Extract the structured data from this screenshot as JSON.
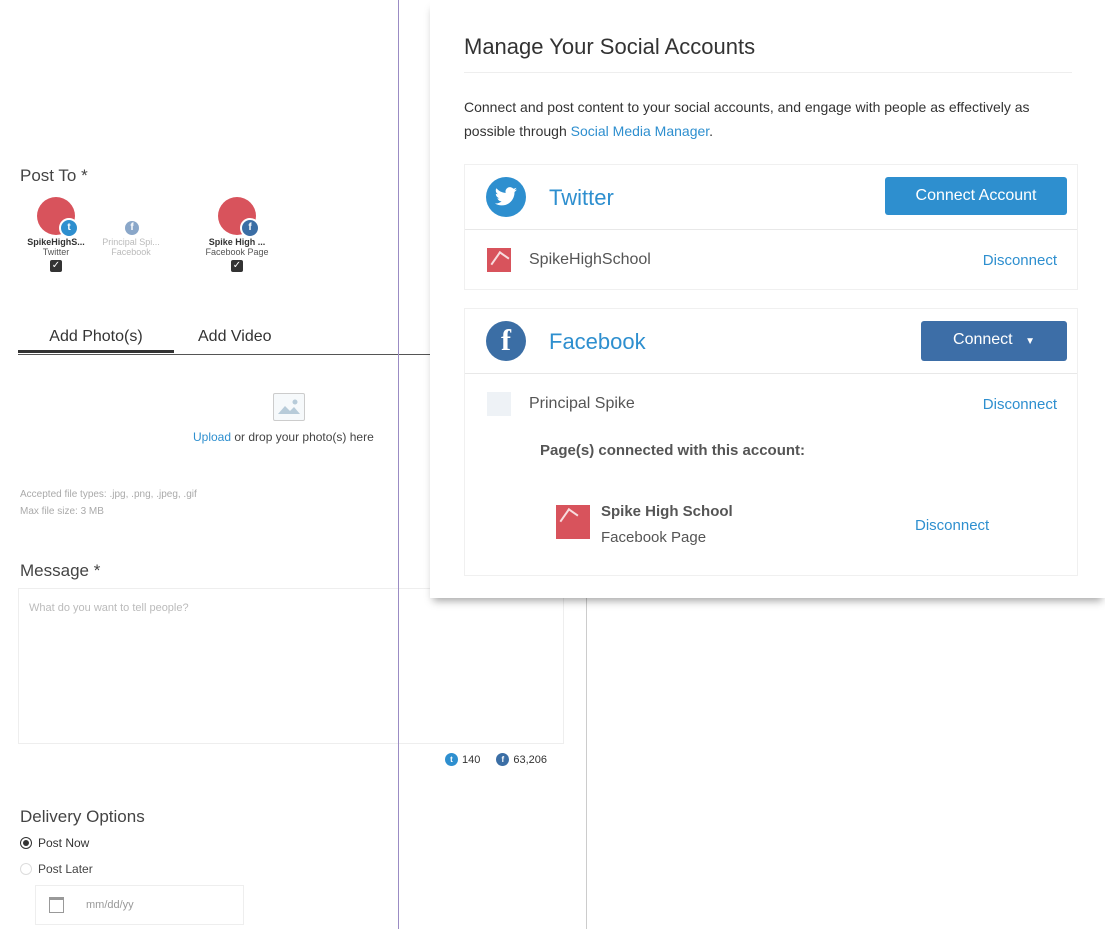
{
  "composer": {
    "post_to_label": "Post To *",
    "accounts": [
      {
        "name": "SpikeHighS...",
        "type": "Twitter",
        "checked": true,
        "network": "twitter"
      },
      {
        "name": "Principal Spi...",
        "type": "Facebook",
        "checked": false,
        "network": "facebook"
      },
      {
        "name": "Spike High ...",
        "type": "Facebook Page",
        "checked": true,
        "network": "facebook"
      }
    ],
    "tabs": [
      "Add Photo(s)",
      "Add Video"
    ],
    "upload": {
      "link": "Upload",
      "text": " or drop your photo(s) here"
    },
    "accepted_types": "Accepted file types: .jpg, .png, .jpeg, .gif",
    "max_size": "Max file size: 3 MB",
    "message_label": "Message *",
    "message_placeholder": "What do you want to tell people?",
    "counters": {
      "twitter": "140",
      "facebook": "63,206"
    },
    "delivery_label": "Delivery Options",
    "delivery_options": [
      {
        "label": "Post Now",
        "selected": true
      },
      {
        "label": "Post Later",
        "selected": false
      }
    ],
    "date_placeholder": "mm/dd/yy"
  },
  "modal": {
    "title": "Manage Your Social Accounts",
    "desc_text": "Connect and post content to your social accounts, and engage with people as effectively as possible through ",
    "desc_link": "Social Media Manager",
    "desc_end": ".",
    "twitter": {
      "name": "Twitter",
      "button": "Connect Account",
      "account": "SpikeHighSchool",
      "disconnect": "Disconnect"
    },
    "facebook": {
      "name": "Facebook",
      "button": "Connect",
      "account": "Principal Spike",
      "disconnect": "Disconnect",
      "pages_label": "Page(s) connected with this account:",
      "page_name": "Spike High School",
      "page_type": "Facebook Page",
      "page_disconnect": "Disconnect"
    }
  },
  "colors": {
    "twitter": "#2e8fcf",
    "facebook": "#3b6ea5",
    "button_blue": "#2e8fcf",
    "button_dark": "#3d6ea7",
    "avatar_red": "#d8535c"
  }
}
